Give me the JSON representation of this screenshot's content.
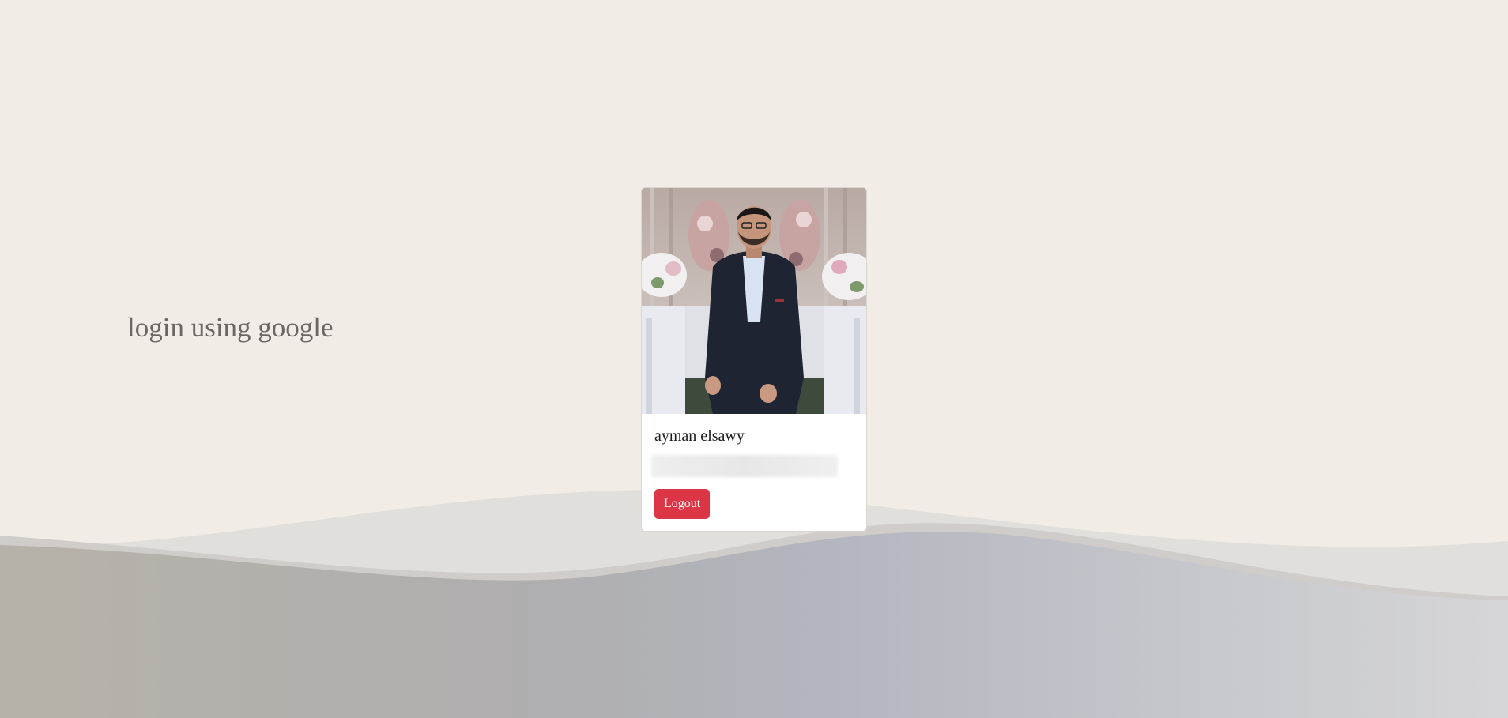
{
  "page": {
    "heading": "login using google"
  },
  "profile": {
    "photo_alt": "ayman elsawy",
    "name": "ayman elsawy",
    "email": "",
    "logout_label": "Logout"
  },
  "colors": {
    "background": "#f1ece6",
    "button": "#dc3545",
    "heading_text": "#6b6863"
  }
}
